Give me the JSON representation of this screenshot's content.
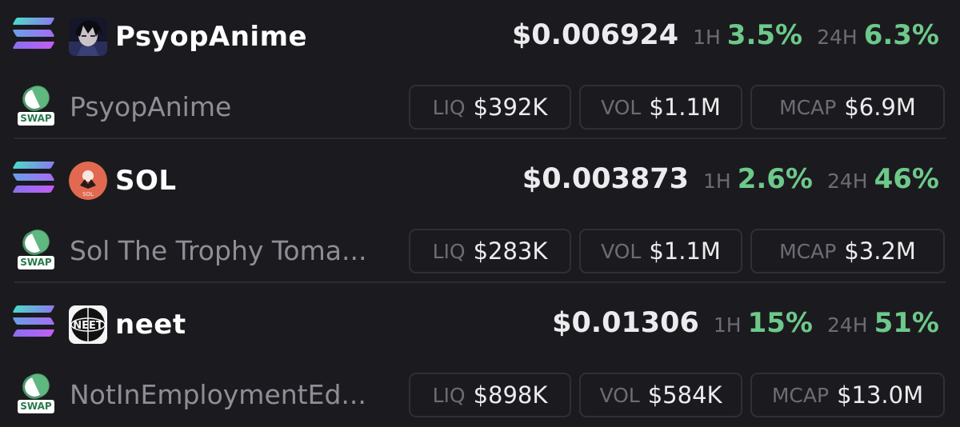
{
  "tokens": [
    {
      "symbol": "PsyopAnime",
      "name": "PsyopAnime",
      "price": "$0.006924",
      "h1_label": "1H",
      "h1_change": "3.5%",
      "h24_label": "24H",
      "h24_change": "6.3%",
      "liq_label": "LIQ",
      "liq": "$392K",
      "vol_label": "VOL",
      "vol": "$1.1M",
      "mcap_label": "MCAP",
      "mcap": "$6.9M",
      "swap_label": "SWAP"
    },
    {
      "symbol": "SOL",
      "name": "Sol The Trophy Toma...",
      "price": "$0.003873",
      "h1_label": "1H",
      "h1_change": "2.6%",
      "h24_label": "24H",
      "h24_change": "46%",
      "liq_label": "LIQ",
      "liq": "$283K",
      "vol_label": "VOL",
      "vol": "$1.1M",
      "mcap_label": "MCAP",
      "mcap": "$3.2M",
      "swap_label": "SWAP",
      "avatar_text": "SOL"
    },
    {
      "symbol": "neet",
      "name": "NotInEmploymentEd...",
      "price": "$0.01306",
      "h1_label": "1H",
      "h1_change": "15%",
      "h24_label": "24H",
      "h24_change": "51%",
      "liq_label": "LIQ",
      "liq": "$898K",
      "vol_label": "VOL",
      "vol": "$584K",
      "mcap_label": "MCAP",
      "mcap": "$13.0M",
      "swap_label": "SWAP",
      "avatar_text": "NEET"
    }
  ],
  "icons": {
    "chain": "solana-icon",
    "dex": "swap-icon"
  },
  "colors": {
    "background": "#1b1b1f",
    "positive": "#6dc98a",
    "muted": "#6c6c74",
    "border": "#2f2f35"
  }
}
